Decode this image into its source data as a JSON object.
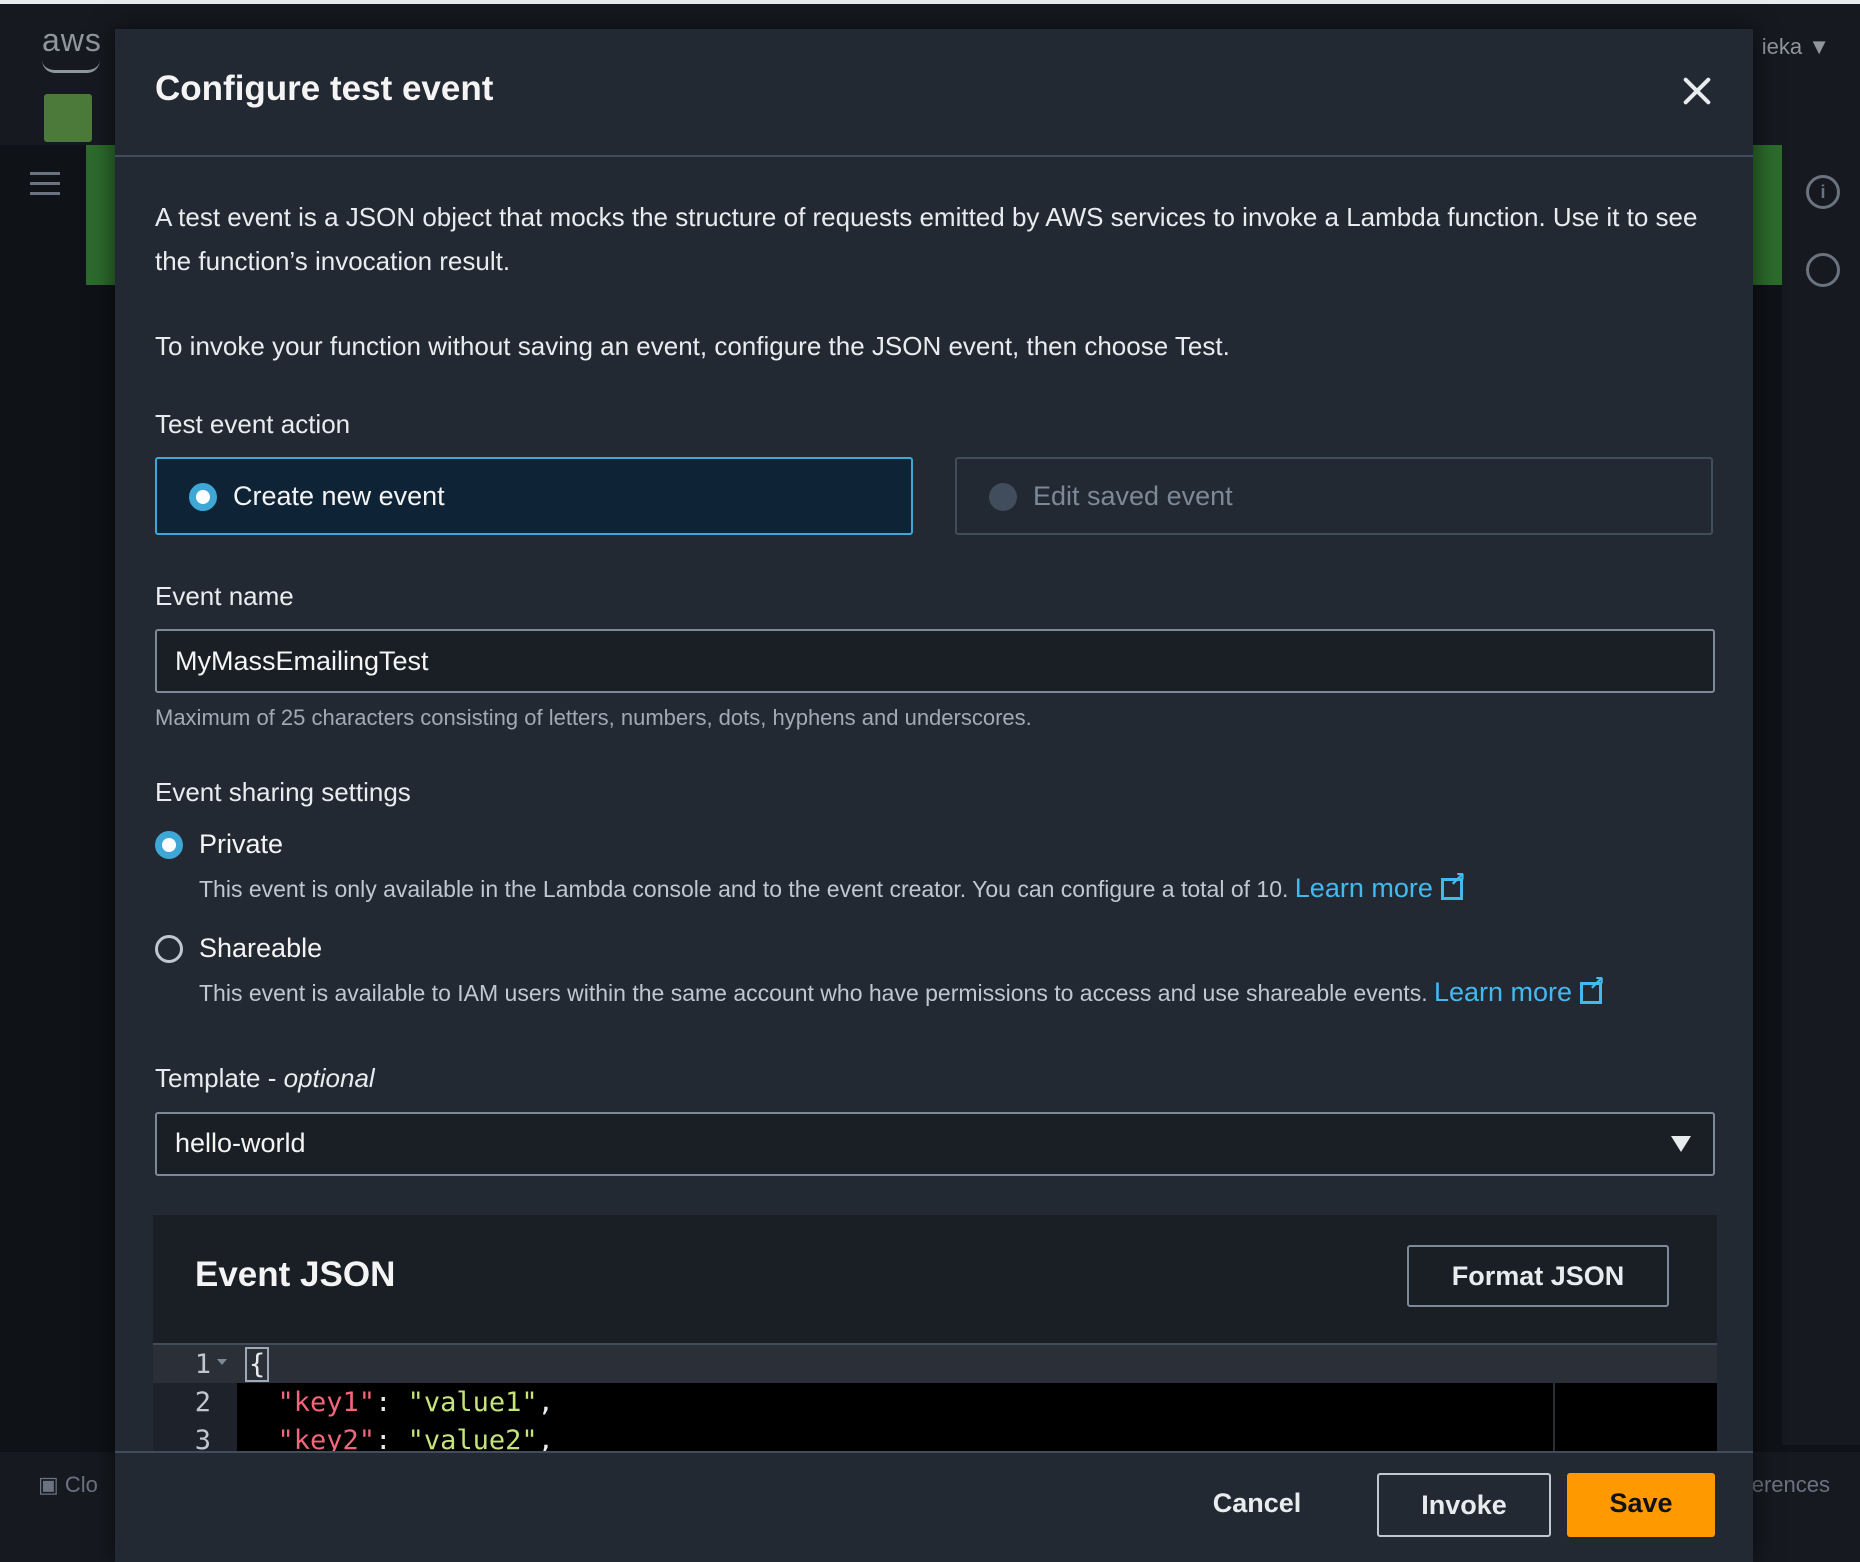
{
  "background": {
    "logo_text": "aws",
    "user_menu": "ieka ▼",
    "bottom_left": "Clo",
    "bottom_right": "erences"
  },
  "modal": {
    "title": "Configure test event",
    "description_1": "A test event is a JSON object that mocks the structure of requests emitted by AWS services to invoke a Lambda function. Use it to see the function’s invocation result.",
    "description_2": "To invoke your function without saving an event, configure the JSON event, then choose Test.",
    "test_event_action": {
      "label": "Test event action",
      "options": [
        "Create new event",
        "Edit saved event"
      ],
      "selected": "Create new event"
    },
    "event_name": {
      "label": "Event name",
      "value": "MyMassEmailingTest",
      "hint": "Maximum of 25 characters consisting of letters, numbers, dots, hyphens and underscores."
    },
    "sharing": {
      "label": "Event sharing settings",
      "options": [
        {
          "label": "Private",
          "description": "This event is only available in the Lambda console and to the event creator. You can configure a total of 10.",
          "link": "Learn more",
          "checked": true
        },
        {
          "label": "Shareable",
          "description": "This event is available to IAM users within the same account who have permissions to access and use shareable events.",
          "link": "Learn more",
          "checked": false
        }
      ]
    },
    "template": {
      "label": "Template - ",
      "label_suffix": "optional",
      "value": "hello-world"
    },
    "event_json": {
      "title": "Event JSON",
      "format_button": "Format JSON",
      "lines": [
        {
          "num": "1",
          "text": "{"
        },
        {
          "num": "2",
          "key": "\"key1\"",
          "value": "\"value1\"",
          "sep": ": ",
          "end": ","
        },
        {
          "num": "3",
          "key": "\"key2\"",
          "value": "\"value2\"",
          "sep": ": ",
          "end": ","
        }
      ]
    },
    "footer": {
      "cancel": "Cancel",
      "invoke": "Invoke",
      "save": "Save"
    }
  }
}
